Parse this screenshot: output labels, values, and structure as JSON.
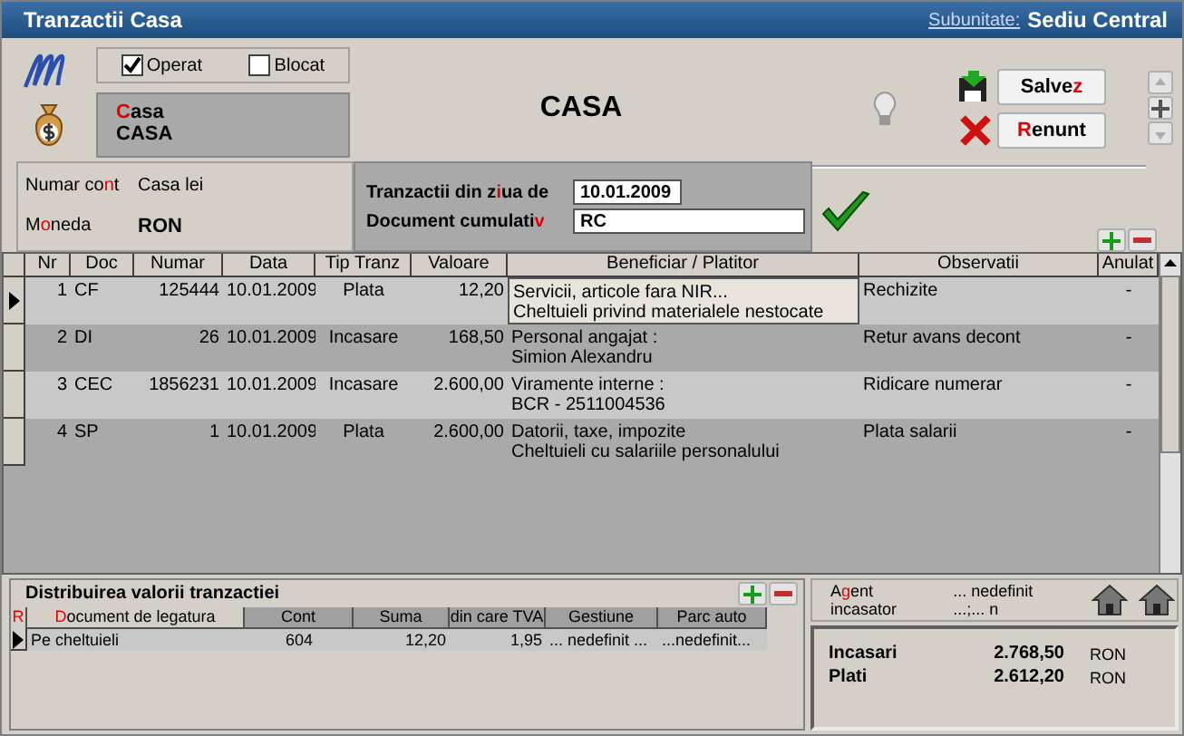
{
  "window": {
    "title": "Tranzactii Casa",
    "subunit_label": "Subunitate:",
    "subunit_value": "Sediu Central"
  },
  "flags": [
    {
      "label": "Operat",
      "checked": true
    },
    {
      "label": "Blocat",
      "checked": false
    }
  ],
  "cash_box": {
    "label": {
      "key": "C",
      "post": "asa"
    },
    "value": "CASA"
  },
  "heading": "CASA",
  "buttons": [
    {
      "kind": "save",
      "label": {
        "pre": "Salve",
        "key": "z"
      }
    },
    {
      "kind": "cancel",
      "label": {
        "key": "R",
        "post": "enunt"
      }
    }
  ],
  "account": [
    {
      "label": {
        "pre": "Numar co",
        "key": "n",
        "post": "t"
      },
      "value": "Casa lei",
      "bold": false
    },
    {
      "label": {
        "pre": "M",
        "key": "o",
        "post": "neda"
      },
      "value": "RON",
      "bold": true
    }
  ],
  "filters": [
    {
      "label": {
        "pre": "Tranzactii din z",
        "key": "i",
        "post": "ua de"
      },
      "value": "10.01.2009",
      "kind": "short"
    },
    {
      "label": {
        "pre": "Document cumulati",
        "key": "v"
      },
      "value": "RC",
      "kind": "long"
    }
  ],
  "transactions": {
    "columns": [
      "Nr",
      "Doc",
      "Numar",
      "Data",
      "Tip Tranz",
      "Valoare",
      "Beneficiar  / Platitor",
      "Observatii",
      "Anulat"
    ],
    "rows": [
      {
        "nr": "1",
        "doc": "CF",
        "numar": "125444",
        "data": "10.01.2009",
        "tip": "Plata",
        "valoare": "12,20",
        "beneficiar": [
          "Servicii, articole fara NIR...",
          "Cheltuieli privind materialele nestocate"
        ],
        "observatii": "Rechizite",
        "anulat": "-",
        "selected": true
      },
      {
        "nr": "2",
        "doc": "DI",
        "numar": "26",
        "data": "10.01.2009",
        "tip": "Incasare",
        "valoare": "168,50",
        "beneficiar": [
          "Personal angajat :",
          "Simion Alexandru"
        ],
        "observatii": "Retur avans decont",
        "anulat": "-",
        "selected": false
      },
      {
        "nr": "3",
        "doc": "CEC",
        "numar": "1856231",
        "data": "10.01.2009",
        "tip": "Incasare",
        "valoare": "2.600,00",
        "beneficiar": [
          "Viramente interne :",
          "BCR - 2511004536"
        ],
        "observatii": "Ridicare numerar",
        "anulat": "-",
        "selected": false
      },
      {
        "nr": "4",
        "doc": "SP",
        "numar": "1",
        "data": "10.01.2009",
        "tip": "Plata",
        "valoare": "2.600,00",
        "beneficiar": [
          "Datorii, taxe, impozite",
          "Cheltuieli cu salariile personalului"
        ],
        "observatii": "Plata salarii",
        "anulat": "-",
        "selected": false
      }
    ]
  },
  "distribution": {
    "title": "Distribuirea valorii tranzactiei",
    "marker": "R",
    "columns": [
      {
        "key": "D",
        "post": "ocument de legatura"
      },
      {
        "pre": "Cont"
      },
      {
        "pre": "Suma"
      },
      {
        "pre": "din care TVA"
      },
      {
        "pre": "Gestiune"
      },
      {
        "pre": "Parc auto"
      }
    ],
    "rows": [
      {
        "cells": [
          "Pe cheltuieli",
          "604",
          "12,20",
          "1,95",
          "... nedefinit ...",
          "...nedefinit..."
        ],
        "selected": true
      }
    ]
  },
  "agent": {
    "label": {
      "pre": "A",
      "key": "g",
      "post": "ent incasator"
    },
    "value": "... nedefinit ...;... n"
  },
  "totals": [
    {
      "label": "Incasari",
      "amount": "2.768,50",
      "currency": "RON"
    },
    {
      "label": "Plati",
      "amount": "2.612,20",
      "currency": "RON"
    }
  ]
}
